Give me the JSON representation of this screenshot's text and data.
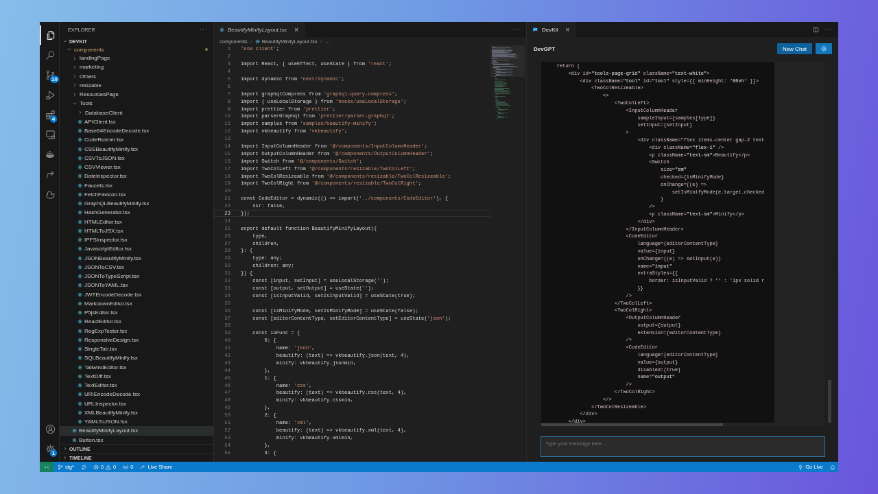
{
  "activity_bar": {
    "top": [
      {
        "kind": "explorer",
        "selected": true
      },
      {
        "kind": "search",
        "selected": false
      },
      {
        "kind": "source_control",
        "selected": false,
        "badge": "10"
      },
      {
        "kind": "run",
        "selected": false
      },
      {
        "kind": "extensions",
        "selected": false,
        "badge": "4"
      },
      {
        "kind": "remote",
        "selected": false
      },
      {
        "kind": "docker",
        "selected": false
      },
      {
        "kind": "live_share",
        "selected": false
      },
      {
        "kind": "duck",
        "selected": false
      }
    ],
    "bottom": [
      {
        "kind": "account"
      },
      {
        "kind": "settings",
        "badge": "1"
      }
    ]
  },
  "sidebar": {
    "title": "EXPLORER",
    "more": "···",
    "section": {
      "label": "DEVKIT",
      "expanded": true
    },
    "tree": [
      {
        "kind": "folder",
        "label": "components",
        "expanded": true,
        "modified": true,
        "selected": false,
        "children": [
          {
            "kind": "folder",
            "label": "landingPage",
            "expanded": false,
            "selected": false
          },
          {
            "kind": "folder",
            "label": "marketing",
            "expanded": false,
            "selected": false
          },
          {
            "kind": "folder",
            "label": "Others",
            "expanded": false,
            "selected": false
          },
          {
            "kind": "folder",
            "label": "resizable",
            "expanded": false,
            "selected": false
          },
          {
            "kind": "folder",
            "label": "ResourcesPage",
            "expanded": false,
            "selected": false
          },
          {
            "kind": "folder",
            "label": "Tools",
            "expanded": true,
            "selected": false,
            "children": [
              {
                "kind": "folder",
                "label": "DatabaseClient",
                "expanded": false,
                "selected": false
              },
              {
                "kind": "file",
                "label": "APIClient.tsx",
                "selected": false
              },
              {
                "kind": "file",
                "label": "Base64EncodeDecode.tsx",
                "selected": false
              },
              {
                "kind": "file",
                "label": "CodeRunner.tsx",
                "selected": false
              },
              {
                "kind": "file",
                "label": "CSSBeautifyMinify.tsx",
                "selected": false
              },
              {
                "kind": "file",
                "label": "CSVToJSON.tsx",
                "selected": false
              },
              {
                "kind": "file",
                "label": "CSVViewer.tsx",
                "selected": false
              },
              {
                "kind": "file",
                "label": "DateInspector.tsx",
                "selected": false
              },
              {
                "kind": "file",
                "label": "Faucets.tsx",
                "selected": false
              },
              {
                "kind": "file",
                "label": "FetchFavicon.tsx",
                "selected": false
              },
              {
                "kind": "file",
                "label": "GraphQLBeautifyMinify.tsx",
                "selected": false
              },
              {
                "kind": "file",
                "label": "HashGenerator.tsx",
                "selected": false
              },
              {
                "kind": "file",
                "label": "HTMLEditor.tsx",
                "selected": false
              },
              {
                "kind": "file",
                "label": "HTMLToJSX.tsx",
                "selected": false
              },
              {
                "kind": "file",
                "label": "IPFSInspector.tsx",
                "selected": false
              },
              {
                "kind": "file",
                "label": "JavascriptEditor.tsx",
                "selected": false
              },
              {
                "kind": "file",
                "label": "JSONBeautifyMinify.tsx",
                "selected": false
              },
              {
                "kind": "file",
                "label": "JSONToCSV.tsx",
                "selected": false
              },
              {
                "kind": "file",
                "label": "JSONToTypeScript.tsx",
                "selected": false
              },
              {
                "kind": "file",
                "label": "JSONToYAML.tsx",
                "selected": false
              },
              {
                "kind": "file",
                "label": "JWTEncodeDecode.tsx",
                "selected": false
              },
              {
                "kind": "file",
                "label": "MarkdownEditor.tsx",
                "selected": false
              },
              {
                "kind": "file",
                "label": "P5jsEditor.tsx",
                "selected": false
              },
              {
                "kind": "file",
                "label": "ReactEditor.tsx",
                "selected": false
              },
              {
                "kind": "file",
                "label": "RegExpTester.tsx",
                "selected": false
              },
              {
                "kind": "file",
                "label": "ResponsiveDesign.tsx",
                "selected": false
              },
              {
                "kind": "file",
                "label": "SingleTab.tsx",
                "selected": false
              },
              {
                "kind": "file",
                "label": "SQLBeautifyMinify.tsx",
                "selected": false
              },
              {
                "kind": "file",
                "label": "TailwindEditor.tsx",
                "selected": false
              },
              {
                "kind": "file",
                "label": "TextDiff.tsx",
                "selected": false
              },
              {
                "kind": "file",
                "label": "TextEditor.tsx",
                "selected": false
              },
              {
                "kind": "file",
                "label": "URIEncodeDecode.tsx",
                "selected": false
              },
              {
                "kind": "file",
                "label": "URLInspector.tsx",
                "selected": false
              },
              {
                "kind": "file",
                "label": "XMLBeautifyMinify.tsx",
                "selected": false
              },
              {
                "kind": "file",
                "label": "YAMLToJSON.tsx",
                "selected": false
              }
            ]
          },
          {
            "kind": "file",
            "label": "BeautifyMinifyLayout.tsx",
            "selected": true
          },
          {
            "kind": "file",
            "label": "Button.tsx",
            "selected": false
          }
        ]
      }
    ],
    "bottom_sections": [
      {
        "label": "OUTLINE",
        "expanded": false
      },
      {
        "label": "TIMELINE",
        "expanded": false
      }
    ]
  },
  "editor": {
    "tab": {
      "label": "BeautifyMinifyLayout.tsx",
      "close": "×"
    },
    "more": "···",
    "breadcrumb": [
      {
        "kind": "folder",
        "label": "components"
      },
      {
        "kind": "file",
        "label": "BeautifyMinifyLayout.tsx"
      },
      {
        "kind": "symbol",
        "label": "…"
      }
    ],
    "lines": [
      {
        "n": "1",
        "text": "'use client';",
        "current": false
      },
      {
        "n": "2",
        "current": false
      },
      {
        "n": "3",
        "text": "import React, { useEffect, useState } from 'react';",
        "current": false
      },
      {
        "n": "4",
        "current": false
      },
      {
        "n": "5",
        "text": "import dynamic from 'next/dynamic';",
        "current": false
      },
      {
        "n": "6",
        "current": false
      },
      {
        "n": "7",
        "text": "import graphqlCompress from 'graphql-query-compress';",
        "current": false
      },
      {
        "n": "8",
        "text": "import { useLocalStorage } from 'hooks/useLocalStorage';",
        "current": false
      },
      {
        "n": "9",
        "text": "import prettier from 'prettier';",
        "current": false
      },
      {
        "n": "10",
        "text": "import parserGraphql from 'prettier/parser-graphql';",
        "current": false
      },
      {
        "n": "11",
        "text": "import samples from 'samples/beautify-minify';",
        "current": false
      },
      {
        "n": "12",
        "text": "import vkbeautify from 'vkbeautify';",
        "current": false
      },
      {
        "n": "13",
        "current": false
      },
      {
        "n": "14",
        "text": "import InputColumnHeader from '@/components/InputColumnHeader';",
        "current": false
      },
      {
        "n": "15",
        "text": "import OutputColumnHeader from '@/components/OutputColumnHeader';",
        "current": false
      },
      {
        "n": "16",
        "text": "import Switch from '@/components/Switch';",
        "current": false
      },
      {
        "n": "17",
        "text": "import TwoColLeft from '@/components/resizable/TwoColLeft';",
        "current": false
      },
      {
        "n": "18",
        "text": "import TwoColResizeable from '@/components/resizable/TwoColResizeable';",
        "current": false
      },
      {
        "n": "19",
        "text": "import TwoColRight from '@/components/resizable/TwoColRight';",
        "current": false
      },
      {
        "n": "20",
        "current": false
      },
      {
        "n": "21",
        "text": "const CodeEditor = dynamic(() => import('../components/CodeEditor'), {",
        "current": false
      },
      {
        "n": "22",
        "text": "    ssr: false,",
        "current": false
      },
      {
        "n": "23",
        "text": "});",
        "current": true
      },
      {
        "n": "24",
        "current": false
      },
      {
        "n": "25",
        "text": "export default function BeautifyMinifyLayout({",
        "current": false
      },
      {
        "n": "26",
        "text": "    type,",
        "current": false
      },
      {
        "n": "27",
        "text": "    children,",
        "current": false
      },
      {
        "n": "28",
        "text": "}: {",
        "current": false
      },
      {
        "n": "29",
        "text": "    type: any;",
        "current": false
      },
      {
        "n": "30",
        "text": "    children: any;",
        "current": false
      },
      {
        "n": "31",
        "text": "}) {",
        "current": false
      },
      {
        "n": "32",
        "text": "    const [input, setInput] = useLocalStorage('');",
        "current": false
      },
      {
        "n": "33",
        "text": "    const [output, setOutput] = useState('');",
        "current": false
      },
      {
        "n": "34",
        "text": "    const [isInputValid, setIsInputValid] = useState(true);",
        "current": false
      },
      {
        "n": "35",
        "current": false
      },
      {
        "n": "36",
        "text": "    const [isMinifyMode, setIsMinifyMode] = useState(false);",
        "current": false
      },
      {
        "n": "37",
        "text": "    const [editorContentType, setEditorContentType] = useState('json');",
        "current": false
      },
      {
        "n": "38",
        "current": false
      },
      {
        "n": "39",
        "text": "    const ioFunc = {",
        "current": false
      },
      {
        "n": "40",
        "text": "        0: {",
        "current": false
      },
      {
        "n": "41",
        "text": "            name: 'json',",
        "current": false
      },
      {
        "n": "42",
        "text": "            beautify: (text) => vkbeautify.json(text, 4),",
        "current": false
      },
      {
        "n": "43",
        "text": "            minify: vkbeautify.jsonmin,",
        "current": false
      },
      {
        "n": "44",
        "text": "        },",
        "current": false
      },
      {
        "n": "45",
        "text": "        1: {",
        "current": false
      },
      {
        "n": "46",
        "text": "            name: 'css',",
        "current": false
      },
      {
        "n": "47",
        "text": "            beautify: (text) => vkbeautify.css(text, 4),",
        "current": false
      },
      {
        "n": "48",
        "text": "            minify: vkbeautify.cssmin,",
        "current": false
      },
      {
        "n": "49",
        "text": "        },",
        "current": false
      },
      {
        "n": "50",
        "text": "        2: {",
        "current": false
      },
      {
        "n": "51",
        "text": "            name: 'xml',",
        "current": false
      },
      {
        "n": "52",
        "text": "            beautify: (text) => vkbeautify.xml(text, 4),",
        "current": false
      },
      {
        "n": "53",
        "text": "            minify: vkbeautify.xmlmin,",
        "current": false
      },
      {
        "n": "54",
        "text": "        },",
        "current": false
      },
      {
        "n": "55",
        "text": "        3: {",
        "current": false
      }
    ]
  },
  "panel": {
    "tab": {
      "label": "DevKit",
      "close": "×"
    },
    "more": "···",
    "title": "DevGPT",
    "new_chat": "New Chat",
    "code": [
      "    return (",
      "        <div id=\"tools-page-grid\" className=\"text-white\">",
      "            <div className=\"tool\" id=\"tool\" style={{ minHeight: '80vh' }}>",
      "                <TwoColResizeable>",
      "                    <>",
      "                        <TwoColLeft>",
      "                            <InputColumnHeader",
      "                                sampleInput={samples[type]}",
      "                                setInput={setInput}",
      "                            >",
      "                                <div className=\"flex items-center gap-2 text",
      "                                    <div className=\"flex-1\" />",
      "                                    <p className=\"text-sm\">Beautify</p>",
      "                                    <Switch",
      "                                        size=\"sm\"",
      "                                        checked={isMinifyMode}",
      "                                        onChange={(e) =>",
      "                                            setIsMinifyMode(e.target.checked",
      "                                        }",
      "                                    />",
      "                                    <p className=\"text-sm\">Minify</p>",
      "                                </div>",
      "                            </InputColumnHeader>",
      "                            <CodeEditor",
      "                                language={editorContentType}",
      "                                value={input}",
      "                                onChange={(e) => setInput(e)}",
      "                                name=\"input\"",
      "                                extraStyles={{",
      "                                    border: isInputValid ? '' : '1px solid r",
      "                                }}",
      "                            />",
      "                        </TwoColLeft>",
      "                        <TwoColRight>",
      "                            <OutputColumnHeader",
      "                                output={output}",
      "                                extension={editorContentType}",
      "                            />",
      "                            <CodeEditor",
      "                                language={editorContentType}",
      "                                value={output}",
      "                                disabled={true}",
      "                                name=\"output\"",
      "                            />",
      "                        </TwoColRight>",
      "                    </>",
      "                </TwoColResizeable>",
      "            </div>",
      "        </div>"
    ],
    "input": {
      "placeholder": "Type your message here..."
    }
  },
  "status_bar": {
    "left": [
      {
        "kind": "remote"
      },
      {
        "kind": "branch",
        "label": "stg*"
      },
      {
        "kind": "sync"
      },
      {
        "kind": "problems",
        "errors": "0",
        "warnings": "0"
      },
      {
        "kind": "ports",
        "label": "0"
      },
      {
        "kind": "live_share",
        "label": "Live Share"
      }
    ],
    "right": [
      {
        "kind": "go_live",
        "label": "Go Live"
      },
      {
        "kind": "bell"
      }
    ]
  }
}
